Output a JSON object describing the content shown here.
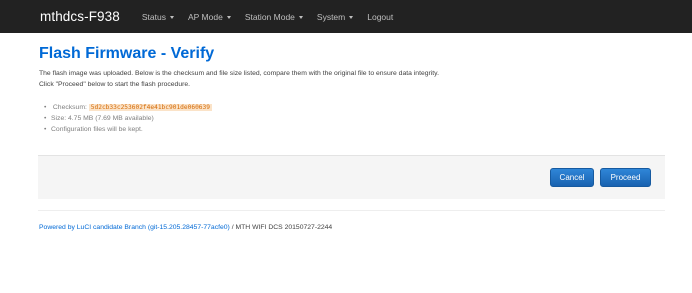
{
  "header": {
    "brand": "mthdcs-F938",
    "menu": [
      {
        "label": "Status",
        "dropdown": true
      },
      {
        "label": "AP Mode",
        "dropdown": true
      },
      {
        "label": "Station Mode",
        "dropdown": true
      },
      {
        "label": "System",
        "dropdown": true
      },
      {
        "label": "Logout",
        "dropdown": false
      }
    ]
  },
  "main": {
    "title": "Flash Firmware - Verify",
    "description_line1": "The flash image was uploaded. Below is the checksum and file size listed, compare them with the original file to ensure data integrity.",
    "description_line2": "Click \"Proceed\" below to start the flash procedure.",
    "info": {
      "checksum_label": "Checksum: ",
      "checksum_value": "5d2cb33c253602f4e41bc901de060639",
      "size_text": "Size: 4.75 MB (7.69 MB available)",
      "config_text": "Configuration files will be kept."
    }
  },
  "actions": {
    "cancel_label": "Cancel",
    "proceed_label": "Proceed"
  },
  "footer": {
    "link_text": "Powered by LuCI candidate Branch (git-15.205.28457-77acfe0)",
    "suffix_text": " / MTH WIFI DCS 20150727-2244"
  },
  "colors": {
    "navbar_bg": "#222222",
    "title_blue": "#0069d6",
    "button_blue": "#1f6fbf",
    "checksum_highlight": "#fbe3c8"
  }
}
